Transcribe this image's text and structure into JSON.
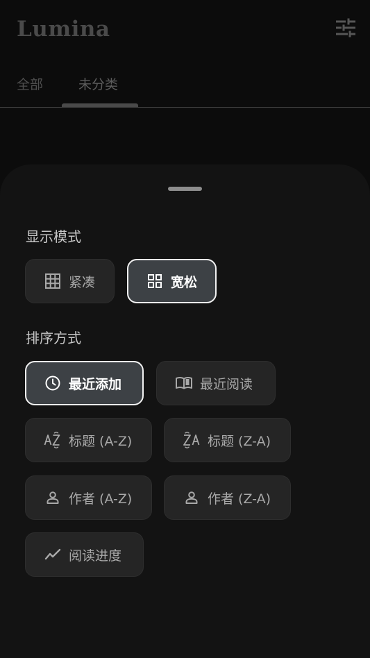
{
  "app": {
    "title": "Lumina"
  },
  "header": {
    "filter_icon": "tune-sliders-icon"
  },
  "tabs": [
    {
      "label": "全部",
      "selected": false
    },
    {
      "label": "未分类",
      "selected": true
    }
  ],
  "sheet": {
    "display_mode": {
      "label": "显示模式",
      "options": [
        {
          "label": "紧凑",
          "icon": "grid-3x3-icon",
          "selected": false
        },
        {
          "label": "宽松",
          "icon": "grid-2x2-icon",
          "selected": true
        }
      ]
    },
    "sort": {
      "label": "排序方式",
      "options": [
        {
          "label": "最近添加",
          "icon": "clock-icon",
          "selected": true
        },
        {
          "label": "最近阅读",
          "icon": "open-book-icon",
          "selected": false
        },
        {
          "label": "标题 (A-Z)",
          "icon": "sort-az-icon",
          "selected": false
        },
        {
          "label": "标题 (Z-A)",
          "icon": "sort-za-icon",
          "selected": false
        },
        {
          "label": "作者 (A-Z)",
          "icon": "person-icon",
          "selected": false
        },
        {
          "label": "作者 (Z-A)",
          "icon": "person-icon",
          "selected": false
        },
        {
          "label": "阅读进度",
          "icon": "trending-line-icon",
          "selected": false
        }
      ]
    }
  },
  "colors": {
    "background": "#0c0c0c",
    "sheet": "#131313",
    "chip": "#252525",
    "chip_selected": "#3d4145",
    "selected_border": "#f2f2f2"
  }
}
